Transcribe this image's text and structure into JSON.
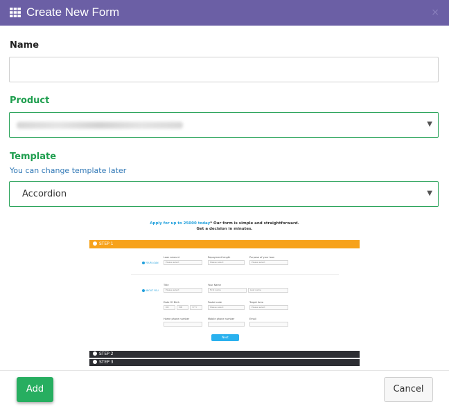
{
  "dialog": {
    "title": "Create New Form",
    "close_glyph": "×"
  },
  "fields": {
    "name": {
      "label": "Name",
      "value": ""
    },
    "product": {
      "label": "Product",
      "value": ""
    },
    "template": {
      "label": "Template",
      "hint": "You can change template later",
      "value": "Accordion"
    }
  },
  "preview": {
    "headline_link": "Apply for up to 25000 today",
    "headline_rest": "* Our form is simple and straightforward.",
    "headline_line2": "Get a decision in minutes.",
    "step1": "STEP 1",
    "step2": "STEP 2",
    "step3": "STEP 3",
    "section1": "YOUR LOAN",
    "section2": "ABOUT YOU",
    "labels": {
      "loan_amount": "Loan amount",
      "repayment_length": "Repayment length",
      "purpose": "Purpose of your loan",
      "title": "Title",
      "your_name": "Your Name",
      "dob": "Date Of Birth",
      "postal_code": "Postal code",
      "target_area": "Target Area",
      "home_phone": "Home phone number",
      "mobile_phone": "Mobile phone number",
      "email": "Email"
    },
    "placeholders": {
      "please_select": "Please select",
      "first_name": "First name",
      "last_name": "Last name",
      "dd": "DD",
      "mm": "MM",
      "yyyy": "YYYY"
    },
    "next": "Next"
  },
  "buttons": {
    "add": "Add",
    "cancel": "Cancel"
  },
  "colors": {
    "header": "#6b5fa5",
    "accent_green": "#27ae60",
    "preview_orange": "#f7a21b",
    "preview_dark": "#2d2e33"
  }
}
